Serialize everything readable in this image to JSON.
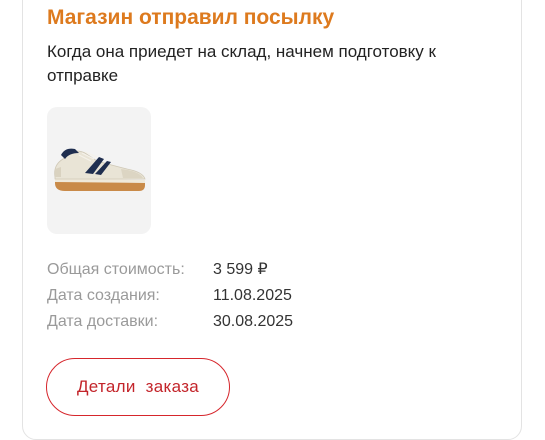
{
  "notification": {
    "title": "Магазин отправил посылку",
    "subtitle": "Когда она приедет на склад, начнем подготовку к отправке"
  },
  "product": {
    "image_icon": "sneaker-product-image"
  },
  "order_info": {
    "total_label": "Общая стоимость:",
    "total_value": "3 599 ₽",
    "created_label": "Дата создания:",
    "created_value": "11.08.2025",
    "delivery_label": "Дата доставки:",
    "delivery_value": "30.08.2025"
  },
  "actions": {
    "details_label": "Детали  заказа"
  },
  "colors": {
    "title": "#dd7a1e",
    "button": "#d6262c"
  }
}
